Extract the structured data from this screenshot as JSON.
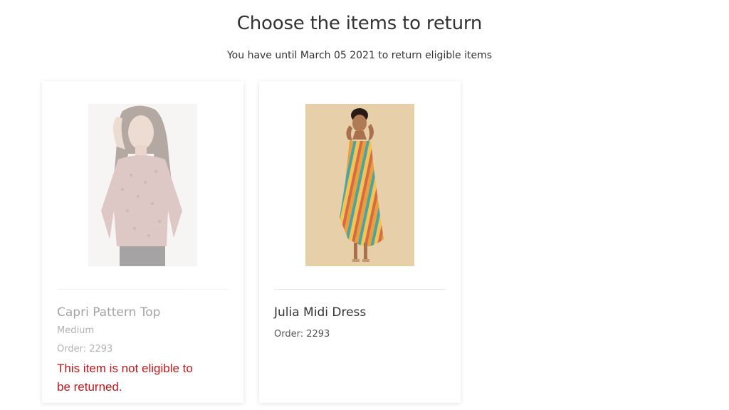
{
  "header": {
    "title": "Choose the items to return",
    "subtitle": "You have until March 05 2021 to return eligible items"
  },
  "items": [
    {
      "name": "Capri Pattern Top",
      "variant": "Medium",
      "order": "Order: 2293",
      "eligible": false,
      "message": "This item is not eligible to be returned."
    },
    {
      "name": "Julia Midi Dress",
      "order": "Order: 2293",
      "eligible": true
    }
  ],
  "colors": {
    "error": "#c0171b",
    "text": "#333333",
    "muted": "#555555"
  }
}
